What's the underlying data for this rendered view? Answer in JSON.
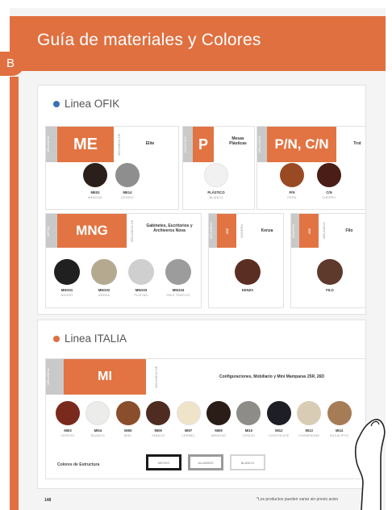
{
  "page": {
    "title": "Guía de materiales y Colores",
    "badge": "B",
    "page_number": "148",
    "footnote": "*Los productos pueden variar sin previo aviso"
  },
  "colors": {
    "accent": "#e07040",
    "ofik_dot": "#3b6fb6",
    "italia_dot": "#e07040"
  },
  "ofik": {
    "title": "Linea OFIK",
    "groups": {
      "me": {
        "strip": "MELAMINA",
        "code": "ME",
        "sub": "MELAMINA DE",
        "desc": "Elite",
        "swatches": [
          {
            "code": "ME03",
            "name": "WENGUE",
            "color": "#2a1f1a"
          },
          {
            "code": "ME14",
            "name": "CENIZO",
            "color": "#8e8e8e"
          }
        ]
      },
      "p": {
        "strip": "PLÁSTICO",
        "code": "P",
        "desc": "Mesas Plásticas",
        "swatches": [
          {
            "code": "PLÁSTICO",
            "name": "BLANCO",
            "color": "#f1f1f1"
          }
        ]
      },
      "pn": {
        "strip": "MELAMINA",
        "code": "P/N, C/N",
        "desc": "Trot",
        "swatches": [
          {
            "code": "P/N",
            "name": "PERA",
            "color": "#9a4a22"
          },
          {
            "code": "C/N",
            "name": "CHERRY",
            "color": "#4a1d16"
          }
        ]
      },
      "mng": {
        "strip": "METAL",
        "code": "MNG",
        "sub": "MELAMINA DE",
        "desc": "Gabinetes, Escritorios y Archiveros Nova",
        "swatches": [
          {
            "code": "MNG01",
            "name": "NEGRO",
            "color": "#202020"
          },
          {
            "code": "MNG02",
            "name": "ARENA",
            "color": "#b5aa90"
          },
          {
            "code": "MNG03",
            "name": "PLATINO",
            "color": "#cfcfcf"
          },
          {
            "code": "MNG04",
            "name": "GRIS TRÁFICO",
            "color": "#9c9c9c"
          }
        ]
      },
      "kenza": {
        "strip": "MELAMINA",
        "code": "ICE",
        "sub": "MADERA",
        "desc": "Kenza",
        "swatches": [
          {
            "code": "KENZA",
            "name": "",
            "color": "#5a2e22"
          }
        ]
      },
      "filo": {
        "strip": "MADERA",
        "code": "ICE",
        "sub": "MELAMINA",
        "desc": "Filo",
        "swatches": [
          {
            "code": "FILO",
            "name": "",
            "color": "#5e3a2c"
          }
        ]
      }
    }
  },
  "italia": {
    "title": "Linea ITALIA",
    "strip": "MELAMINA",
    "code": "MI",
    "sub": "MELAMINA DE",
    "desc": "Configuraciones, Mobiliario y Mini Mamparas 25R, 26D",
    "swatches": [
      {
        "code": "MI03",
        "name": "CEREZO",
        "color": "#7a2a1c"
      },
      {
        "code": "MI04",
        "name": "BLANCO",
        "color": "#ececea"
      },
      {
        "code": "MI05",
        "name": "MIEL",
        "color": "#8a4e2c"
      },
      {
        "code": "MI06",
        "name": "TABACO",
        "color": "#4e2c22"
      },
      {
        "code": "MI07",
        "name": "CERMEL",
        "color": "#efe3c8"
      },
      {
        "code": "MI09",
        "name": "WENGUE",
        "color": "#2a1c16"
      },
      {
        "code": "MI10",
        "name": "CENIZO",
        "color": "#8e8c88"
      },
      {
        "code": "MI12",
        "name": "CHOCOLATE",
        "color": "#1e1e26"
      },
      {
        "code": "MI13",
        "name": "CHAMPAGNE",
        "color": "#d8cdb4"
      },
      {
        "code": "MI14",
        "name": "EUCALIPTO",
        "color": "#a67c56"
      }
    ],
    "structure": {
      "label": "Colores de Estructura",
      "options": [
        "NEGRO",
        "ALUMINIO",
        "BLANCO"
      ]
    }
  }
}
